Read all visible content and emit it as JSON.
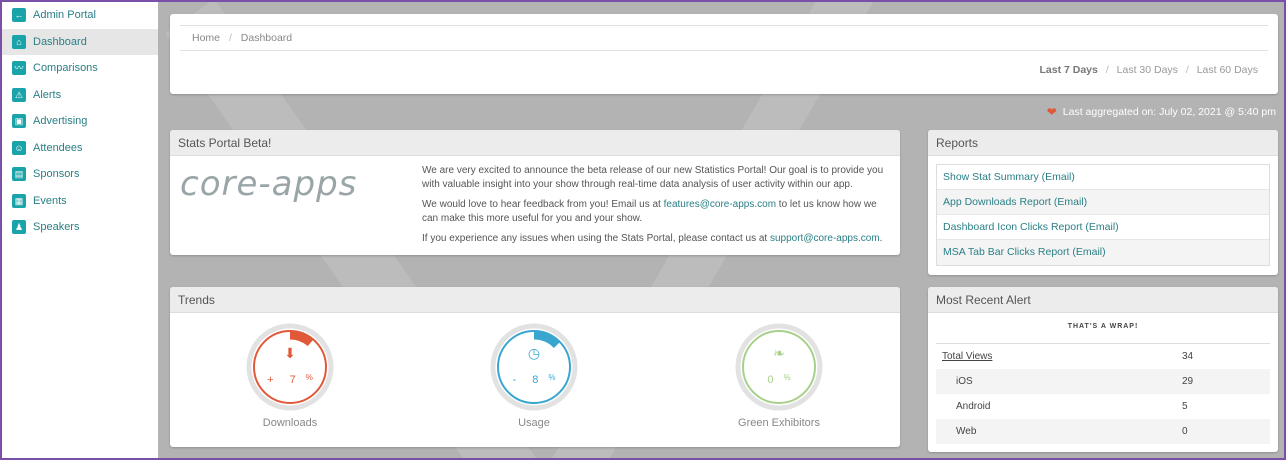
{
  "sidebar": {
    "items": [
      {
        "label": "Admin Portal",
        "icon": "arrow-left-icon",
        "glyph": "←"
      },
      {
        "label": "Dashboard",
        "icon": "home-icon",
        "glyph": "⌂"
      },
      {
        "label": "Comparisons",
        "icon": "chart-icon",
        "glyph": "〰"
      },
      {
        "label": "Alerts",
        "icon": "warning-icon",
        "glyph": "⚠"
      },
      {
        "label": "Advertising",
        "icon": "image-icon",
        "glyph": "▣"
      },
      {
        "label": "Attendees",
        "icon": "users-icon",
        "glyph": "☺"
      },
      {
        "label": "Sponsors",
        "icon": "briefcase-icon",
        "glyph": "▤"
      },
      {
        "label": "Events",
        "icon": "calendar-icon",
        "glyph": "▦"
      },
      {
        "label": "Speakers",
        "icon": "user-icon",
        "glyph": "♟"
      }
    ]
  },
  "breadcrumb": {
    "home": "Home",
    "sep": "/",
    "current": "Dashboard"
  },
  "ranges": {
    "last7": "Last 7 Days",
    "last30": "Last 30 Days",
    "last60": "Last 60 Days",
    "sep": "/"
  },
  "aggregated": "Last aggregated on: July 02, 2021 @ 5:40 pm",
  "beta": {
    "title": "Stats Portal Beta!",
    "logo": "core-apps",
    "p1": "We are very excited to announce the beta release of our new Statistics Portal! Our goal is to provide you with valuable insight into your show through real-time data analysis of user activity within our app.",
    "p2_pre": "We would love to hear feedback from you! Email us at ",
    "p2_link": "features@core-apps.com",
    "p2_post": " to let us know how we can make this more useful for you and your show.",
    "p3_pre": "If you experience any issues when using the Stats Portal, please contact us at ",
    "p3_link": "support@core-apps.com",
    "p3_post": "."
  },
  "reports": {
    "title": "Reports",
    "items": [
      "Show Stat Summary (Email)",
      "App Downloads Report (Email)",
      "Dashboard Icon Clicks Report (Email)",
      "MSA Tab Bar Clicks Report (Email)"
    ]
  },
  "trends": {
    "title": "Trends",
    "gauges": [
      {
        "label": "Downloads",
        "sign": "+",
        "value": "7",
        "unit": "%",
        "color": "#e05a3a",
        "icon": "download-icon",
        "fraction": 0.07
      },
      {
        "label": "Usage",
        "sign": "-",
        "value": "8",
        "unit": "%",
        "color": "#3aa6d0",
        "icon": "clock-icon",
        "fraction": 0.08
      },
      {
        "label": "Green Exhibitors",
        "sign": "",
        "value": "0",
        "unit": "%",
        "color": "#a8d08a",
        "icon": "leaf-icon",
        "fraction": 0
      }
    ]
  },
  "alert": {
    "title": "Most Recent Alert",
    "name": "THAT'S A WRAP!",
    "rows": [
      {
        "key": "Total Views",
        "value": "34"
      },
      {
        "key": "iOS",
        "value": "29"
      },
      {
        "key": "Android",
        "value": "5"
      },
      {
        "key": "Web",
        "value": "0"
      }
    ]
  }
}
